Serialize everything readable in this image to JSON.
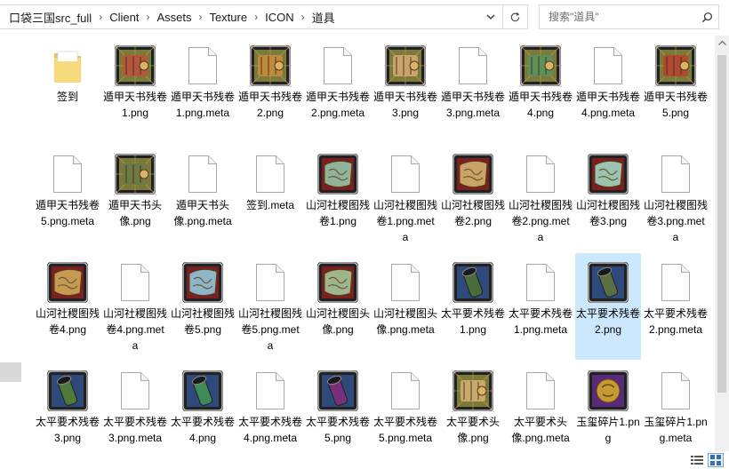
{
  "address": {
    "crumbs": [
      "口袋三国src_full",
      "Client",
      "Assets",
      "Texture",
      "ICON",
      "道具"
    ],
    "dropdown_icon": "chevron-down-icon",
    "refresh_icon": "refresh-icon"
  },
  "search": {
    "placeholder": "搜索\"道具\"",
    "icon": "magnifier-icon"
  },
  "files": [
    {
      "name": "签到",
      "kind": "folder"
    },
    {
      "name": "遁甲天书残卷1.png",
      "kind": "scroll",
      "color": "#b5573a"
    },
    {
      "name": "遁甲天书残卷1.png.meta",
      "kind": "doc"
    },
    {
      "name": "遁甲天书残卷2.png",
      "kind": "scroll",
      "color": "#c08a3c"
    },
    {
      "name": "遁甲天书残卷2.png.meta",
      "kind": "doc"
    },
    {
      "name": "遁甲天书残卷3.png",
      "kind": "scroll",
      "color": "#c9a46a"
    },
    {
      "name": "遁甲天书残卷3.png.meta",
      "kind": "doc"
    },
    {
      "name": "遁甲天书残卷4.png",
      "kind": "scroll",
      "color": "#5f8f5a"
    },
    {
      "name": "遁甲天书残卷4.png.meta",
      "kind": "doc"
    },
    {
      "name": "遁甲天书残卷5.png",
      "kind": "scroll",
      "color": "#b04a2f"
    },
    {
      "name": "遁甲天书残卷5.png.meta",
      "kind": "doc"
    },
    {
      "name": "遁甲天书头像.png",
      "kind": "scroll",
      "color": "#6e7a45"
    },
    {
      "name": "遁甲天书头像.png.meta",
      "kind": "doc"
    },
    {
      "name": "签到.meta",
      "kind": "doc"
    },
    {
      "name": "山河社稷图残卷1.png",
      "kind": "map",
      "color": "#8fb49a"
    },
    {
      "name": "山河社稷图残卷1.png.meta",
      "kind": "doc"
    },
    {
      "name": "山河社稷图残卷2.png",
      "kind": "map",
      "color": "#c8a466"
    },
    {
      "name": "山河社稷图残卷2.png.meta",
      "kind": "doc"
    },
    {
      "name": "山河社稷图残卷3.png",
      "kind": "map",
      "color": "#9cc3b0"
    },
    {
      "name": "山河社稷图残卷3.png.meta",
      "kind": "doc"
    },
    {
      "name": "山河社稷图残卷4.png",
      "kind": "map",
      "color": "#c79a52"
    },
    {
      "name": "山河社稷图残卷4.png.meta",
      "kind": "doc"
    },
    {
      "name": "山河社稷图残卷5.png",
      "kind": "map",
      "color": "#8db6c9"
    },
    {
      "name": "山河社稷图残卷5.png.meta",
      "kind": "doc"
    },
    {
      "name": "山河社稷图头像.png",
      "kind": "map",
      "color": "#9fb58c"
    },
    {
      "name": "山河社稷图头像.png.meta",
      "kind": "doc"
    },
    {
      "name": "太平要术残卷1.png",
      "kind": "tube",
      "color": "#4a6b3a"
    },
    {
      "name": "太平要术残卷1.png.meta",
      "kind": "doc"
    },
    {
      "name": "太平要术残卷2.png",
      "kind": "tube",
      "color": "#5a6e44",
      "selected": true
    },
    {
      "name": "太平要术残卷2.png.meta",
      "kind": "doc"
    },
    {
      "name": "太平要术残卷3.png",
      "kind": "tube",
      "color": "#4f7a3a"
    },
    {
      "name": "太平要术残卷3.png.meta",
      "kind": "doc"
    },
    {
      "name": "太平要术残卷4.png",
      "kind": "tube",
      "color": "#3f8a58"
    },
    {
      "name": "太平要术残卷4.png.meta",
      "kind": "doc"
    },
    {
      "name": "太平要术残卷5.png",
      "kind": "tube",
      "color": "#7a2f7a"
    },
    {
      "name": "太平要术残卷5.png.meta",
      "kind": "doc"
    },
    {
      "name": "太平要术头像.png",
      "kind": "scroll",
      "color": "#c9a96a"
    },
    {
      "name": "太平要术头像.png.meta",
      "kind": "doc"
    },
    {
      "name": "玉玺碎片1.png",
      "kind": "seal",
      "color": "#c59a35"
    },
    {
      "name": "玉玺碎片1.png.meta",
      "kind": "doc"
    }
  ],
  "status": {
    "details_view_icon": "details-view-icon",
    "large_icons_view_icon": "large-icons-view-icon"
  }
}
